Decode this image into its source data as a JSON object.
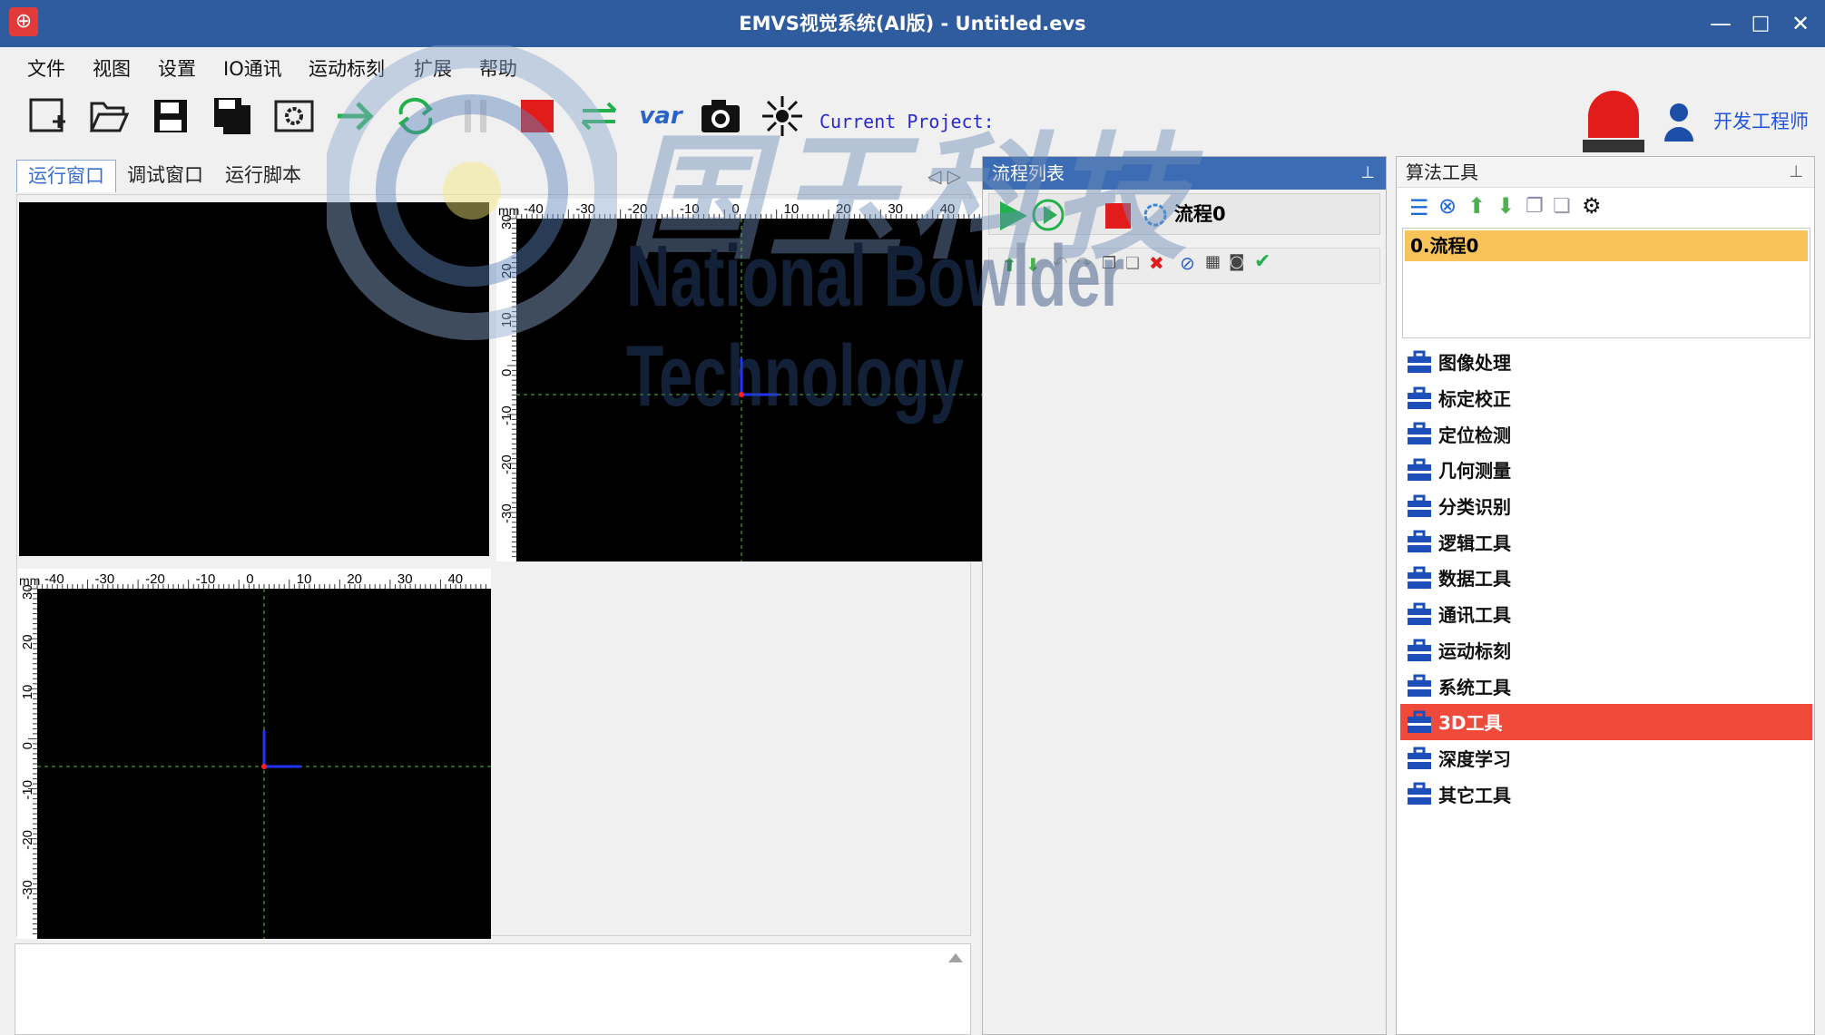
{
  "window": {
    "title": "EMVS视觉系统(AI版) - Untitled.evs",
    "app_icon": "app-logo-icon",
    "minimize": "—",
    "maximize": "□",
    "close": "✕"
  },
  "menu": [
    "文件",
    "视图",
    "设置",
    "IO通讯",
    "运动标刻",
    "扩展",
    "帮助"
  ],
  "toolbar": {
    "icons": [
      "new-project-icon",
      "open-folder-icon",
      "save-icon",
      "save-as-icon",
      "settings-icon",
      "run-once-icon",
      "run-loop-icon",
      "pause-icon",
      "stop-icon",
      "switch-icon",
      "var-icon",
      "camera-icon",
      "light-icon"
    ],
    "var_label": "var",
    "current_project_label": "Current Project:",
    "user_label": "开发工程师"
  },
  "tabs": [
    "运行窗口",
    "调试窗口",
    "运行脚本"
  ],
  "ruler": {
    "unit": "mm",
    "x_ticks": [
      "-40",
      "-30",
      "-20",
      "-10",
      "0",
      "10",
      "20",
      "30",
      "40"
    ],
    "y_ticks": [
      "30",
      "20",
      "10",
      "0",
      "-10",
      "-20",
      "-30"
    ]
  },
  "flow_panel": {
    "title": "流程列表",
    "flow_name": "流程0"
  },
  "algo_panel": {
    "title": "算法工具",
    "flows": [
      "0.流程0"
    ],
    "tools": [
      "图像处理",
      "标定校正",
      "定位检测",
      "几何测量",
      "分类识别",
      "逻辑工具",
      "数据工具",
      "通讯工具",
      "运动标刻",
      "系统工具",
      "3D工具",
      "深度学习",
      "其它工具"
    ],
    "selected_tool": "3D工具"
  },
  "watermark": {
    "cn": "国玉科技",
    "en": "National Bowlder Technology"
  },
  "colors": {
    "titlebar": "#2e5c9e",
    "selected": "#f04a3a",
    "flow_item": "#f7c35a",
    "alarm": "#e21b1b",
    "accent_blue": "#2255dd"
  }
}
